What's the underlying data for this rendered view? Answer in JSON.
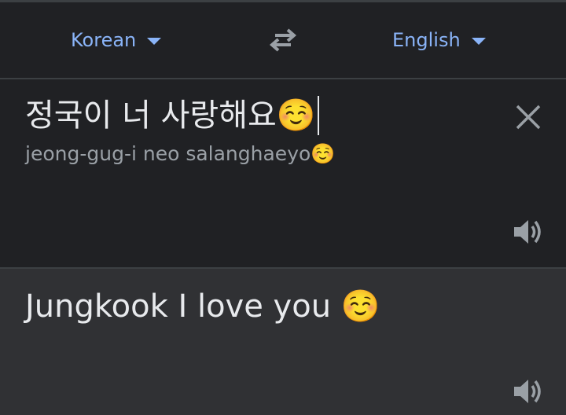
{
  "languages": {
    "source": "Korean",
    "target": "English"
  },
  "input": {
    "text": "정국이 너 사랑해요☺️",
    "transliteration": "jeong-gug-i neo salanghaeyo☺️"
  },
  "output": {
    "text": "Jungkook I love you ☺️"
  },
  "icons": {
    "swap": "swap-arrows-icon",
    "clear": "close-icon",
    "speaker": "speaker-icon"
  },
  "colors": {
    "accent": "#8ab4f8",
    "background": "#202124",
    "output_background": "#303134",
    "text": "#e8eaed",
    "secondary_text": "#9aa0a6"
  }
}
